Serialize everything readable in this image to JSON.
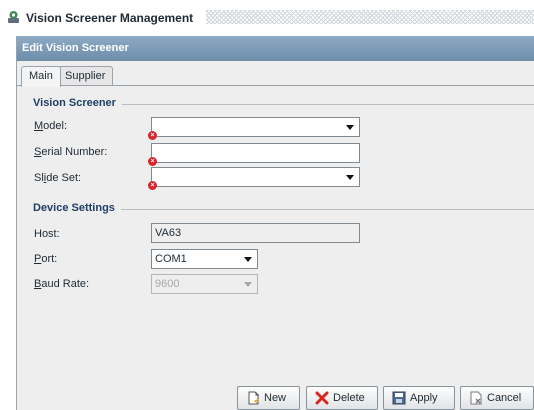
{
  "window": {
    "title": "Vision Screener Management",
    "icon": "app-icon"
  },
  "panel": {
    "header": "Edit Vision Screener"
  },
  "tabs": [
    {
      "label": "Main",
      "active": true
    },
    {
      "label": "Supplier",
      "active": false
    }
  ],
  "vision_screener": {
    "title": "Vision Screener",
    "model": {
      "label": "Model:",
      "value": ""
    },
    "serial": {
      "label": "Serial Number:",
      "value": ""
    },
    "slide_set": {
      "label": "Slide Set:",
      "value": ""
    }
  },
  "device_settings": {
    "title": "Device Settings",
    "host": {
      "label": "Host:",
      "value": "VA63"
    },
    "port": {
      "label": "Port:",
      "value": "COM1"
    },
    "baud_rate": {
      "label": "Baud Rate:",
      "value": "9600"
    }
  },
  "buttons": {
    "new": "New",
    "delete": "Delete",
    "apply": "Apply",
    "cancel": "Cancel"
  },
  "colors": {
    "header_bg": "#7b98b4",
    "error_marker": "#d8262a",
    "group_title": "#1f3f66"
  }
}
